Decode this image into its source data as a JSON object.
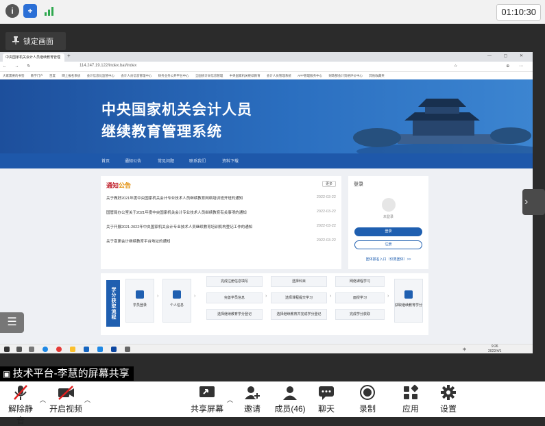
{
  "top_bar": {
    "clock": "01:10:30"
  },
  "lock_button": {
    "label": "锁定画面"
  },
  "browser": {
    "tab_title": "中央国家机关会计人员继续教育管理",
    "url": "114.247.19.122/index.bat/index",
    "bookmarks": [
      "大家需要的书签",
      "教学门户",
      "百度",
      "网上报名系统",
      "会计信息化监管中心",
      "会计人员信息管理中心",
      "财务业务公开平台中心",
      "全国统计局信息管理",
      "中央国家机关继续教育",
      "会计人员管理系统",
      "APP管理服务中心",
      "财政部会计资格评价中心",
      "其他收藏夹"
    ]
  },
  "site": {
    "title_line1": "中央国家机关会计人员",
    "title_line2": "继续教育管理系统",
    "nav": [
      "首页",
      "通知公告",
      "常见问题",
      "联系我们",
      "资料下载"
    ],
    "notice": {
      "title_a": "通知",
      "title_b": "公告",
      "more": "更多",
      "items": [
        {
          "text": "关于做好2021年度中央国家机关会计专业技术人员继续教育网络培训班开班的通知",
          "date": "2022-03-22"
        },
        {
          "text": "国管局办公室关于2021年度中央国家机关会计专业技术人员继续教育有关事项的通知",
          "date": "2022-03-22"
        },
        {
          "text": "关于开展2021-2022年中央国家机关会计专业技术人员继续教育培训机构登记工作的通知",
          "date": "2022-03-22"
        },
        {
          "text": "关于变更会计继续教育平台地址的通知",
          "date": "2022-03-22"
        }
      ]
    },
    "login": {
      "title": "登录",
      "user": "未登录",
      "login_btn": "登录",
      "register_btn": "注册",
      "group_link": "团体报名入口（仅限团体）>>"
    },
    "flow": {
      "header": "学分获取流程",
      "start": "学员登录",
      "step2": "个人信息",
      "col1": [
        "完成注册信息填写",
        "完善学员信息",
        "选择继续教育学分登记"
      ],
      "col2": [
        "选择科目",
        "选择课程提交学习",
        "选择继续教育并完成学分登记"
      ],
      "col3": [
        "网络课程学习",
        "面授学习",
        "完成学分获取"
      ],
      "end": "获取继续教育学分"
    }
  },
  "taskbar": {
    "time": "9:26",
    "date": "2022/4/1",
    "lang": "中"
  },
  "share_label": "技术平台-李慧的屏幕共享",
  "toolbar": {
    "mute": "解除静音",
    "video": "开启视频",
    "share": "共享屏幕",
    "invite": "邀请",
    "members": "成员(46)",
    "chat": "聊天",
    "record": "录制",
    "apps": "应用",
    "settings": "设置"
  }
}
